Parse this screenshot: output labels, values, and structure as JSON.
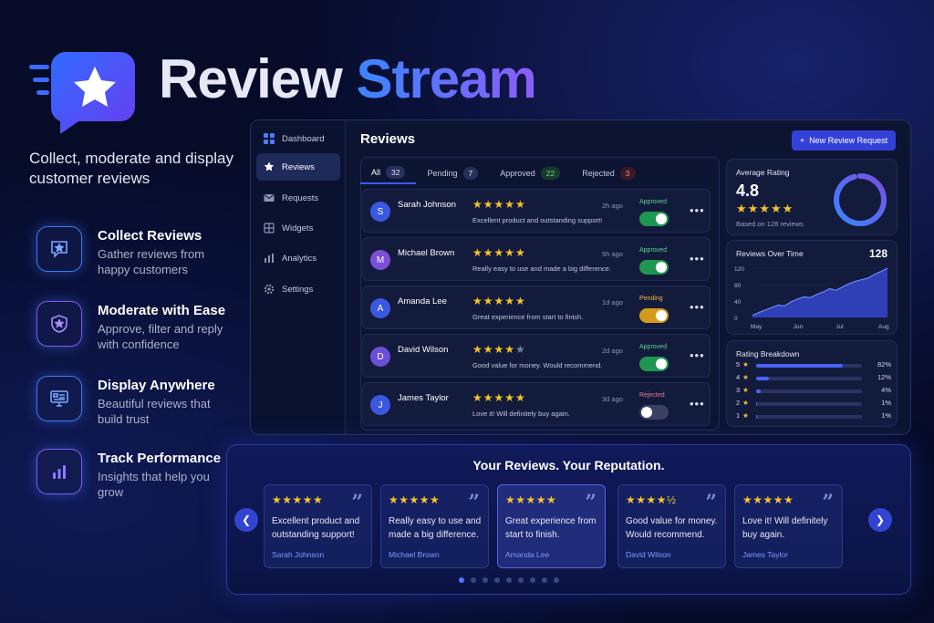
{
  "brand": {
    "word1": "Review",
    "word2": "Stream",
    "tagline": "Collect, moderate and display customer reviews"
  },
  "features": [
    {
      "title": "Collect Reviews",
      "desc": "Gather reviews from happy customers",
      "icon": "chat-star-icon"
    },
    {
      "title": "Moderate with Ease",
      "desc": "Approve, filter and reply with confidence",
      "icon": "shield-star-icon"
    },
    {
      "title": "Display Anywhere",
      "desc": "Beautiful reviews that build trust",
      "icon": "monitor-icon"
    },
    {
      "title": "Track Performance",
      "desc": "Insights that help you grow",
      "icon": "bar-chart-icon"
    }
  ],
  "sidebar": {
    "items": [
      {
        "label": "Dashboard",
        "icon": "grid-icon"
      },
      {
        "label": "Reviews",
        "icon": "star-icon"
      },
      {
        "label": "Requests",
        "icon": "mail-icon"
      },
      {
        "label": "Widgets",
        "icon": "widget-icon"
      },
      {
        "label": "Analytics",
        "icon": "analytics-icon"
      },
      {
        "label": "Settings",
        "icon": "gear-icon"
      }
    ]
  },
  "main": {
    "title": "Reviews",
    "new_button": "New Review Request",
    "tabs": [
      {
        "label": "All",
        "count": "32"
      },
      {
        "label": "Pending",
        "count": "7"
      },
      {
        "label": "Approved",
        "count": "22"
      },
      {
        "label": "Rejected",
        "count": "3"
      }
    ],
    "reviews": [
      {
        "initial": "S",
        "name": "Sarah Johnson",
        "rating": 5,
        "text": "Excellent product and outstanding support!",
        "time": "2h ago",
        "status": "Approved",
        "enabled": true,
        "color": "#3a58e0"
      },
      {
        "initial": "M",
        "name": "Michael Brown",
        "rating": 5,
        "text": "Really easy to use and made a big difference.",
        "time": "5h ago",
        "status": "Approved",
        "enabled": true,
        "color": "#7a4fd6"
      },
      {
        "initial": "A",
        "name": "Amanda Lee",
        "rating": 5,
        "text": "Great experience from start to finish.",
        "time": "1d ago",
        "status": "Pending",
        "enabled": true,
        "color": "#3a58e0"
      },
      {
        "initial": "D",
        "name": "David Wilson",
        "rating": 4,
        "text": "Good value for money. Would recommend.",
        "time": "2d ago",
        "status": "Approved",
        "enabled": true,
        "color": "#6b4fd6"
      },
      {
        "initial": "J",
        "name": "James Taylor",
        "rating": 5,
        "text": "Love it! Will definitely buy again.",
        "time": "3d ago",
        "status": "Rejected",
        "enabled": false,
        "color": "#3a58e0"
      }
    ]
  },
  "stats": {
    "avg_title": "Average Rating",
    "avg_value": "4.8",
    "based_on": "Based on 128 reviews",
    "donut_fraction": 0.96,
    "over_time_title": "Reviews Over Time",
    "over_time_total": "128",
    "chart": {
      "y_ticks": [
        "120",
        "80",
        "40",
        "0"
      ],
      "x_ticks": [
        "May",
        "Jun",
        "Jul",
        "Aug"
      ],
      "values": [
        5,
        12,
        18,
        24,
        30,
        28,
        38,
        45,
        50,
        48,
        56,
        62,
        70,
        66,
        74,
        82,
        88,
        92,
        96,
        105,
        112,
        120
      ]
    },
    "breakdown_title": "Rating Breakdown",
    "breakdown": [
      {
        "star": "5",
        "pct": "82%",
        "value": 0.82
      },
      {
        "star": "4",
        "pct": "12%",
        "value": 0.12
      },
      {
        "star": "3",
        "pct": "4%",
        "value": 0.04
      },
      {
        "star": "2",
        "pct": "1%",
        "value": 0.01
      },
      {
        "star": "1",
        "pct": "1%",
        "value": 0.01
      }
    ]
  },
  "showcase": {
    "title": "Your Reviews. Your Reputation.",
    "cards": [
      {
        "stars": "★★★★★",
        "text": "Excellent product and outstanding support!",
        "name": "Sarah Johnson"
      },
      {
        "stars": "★★★★★",
        "text": "Really easy to use and made a big difference.",
        "name": "Michael Brown"
      },
      {
        "stars": "★★★★★",
        "text": "Great experience from start to finish.",
        "name": "Amanda Lee"
      },
      {
        "stars": "★★★★½",
        "text": "Good value for money. Would recommend.",
        "name": "David Wilson"
      },
      {
        "stars": "★★★★★",
        "text": "Love it! Will definitely buy again.",
        "name": "James Taylor"
      }
    ],
    "page_count": 9,
    "active_page": 0
  },
  "colors": {
    "accent": "#3341d9",
    "approved": "#5bd58a",
    "pending": "#f0b73a",
    "rejected": "#f07a8a",
    "star": "#f7c325"
  }
}
